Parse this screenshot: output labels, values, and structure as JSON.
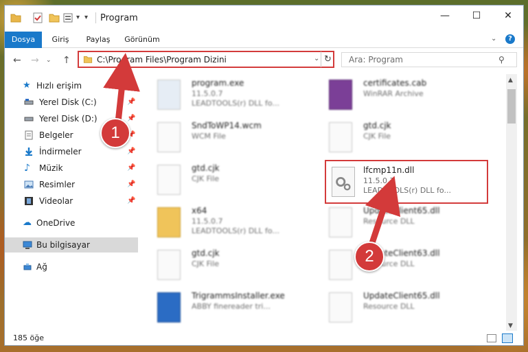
{
  "window": {
    "title": "Program"
  },
  "ribbon": {
    "tabs": [
      "Dosya",
      "Giriş",
      "Paylaş",
      "Görünüm"
    ]
  },
  "address": {
    "path": "C:\\Program Files\\Program Dizini"
  },
  "search": {
    "placeholder": "Ara: Program"
  },
  "nav": {
    "items": [
      {
        "label": "Hızlı erişim"
      },
      {
        "label": "Yerel Disk (C:)"
      },
      {
        "label": "Yerel Disk (D:)"
      },
      {
        "label": "Belgeler"
      },
      {
        "label": "İndirmeler"
      },
      {
        "label": "Müzik"
      },
      {
        "label": "Resimler"
      },
      {
        "label": "Videolar"
      },
      {
        "label": "OneDrive"
      },
      {
        "label": "Bu bilgisayar"
      },
      {
        "label": "Ağ"
      }
    ]
  },
  "files": [
    {
      "name": "program.exe",
      "meta1": "11.5.0.7",
      "meta2": "LEADTOOLS(r) DLL fo..."
    },
    {
      "name": "certificates.cab",
      "meta1": "WinRAR Archive",
      "meta2": ""
    },
    {
      "name": "SndToWP14.wcm",
      "meta1": "WCM File",
      "meta2": ""
    },
    {
      "name": "gtd.cjk",
      "meta1": "CJK File",
      "meta2": ""
    },
    {
      "name": "gtd.cjk",
      "meta1": "CJK File",
      "meta2": ""
    },
    {
      "name": "lfcmp11n.dll",
      "meta1": "11.5.0.7",
      "meta2": "LEADTOOLS(r) DLL fo..."
    },
    {
      "name": "x64",
      "meta1": "11.5.0.7",
      "meta2": "LEADTOOLS(r) DLL fo..."
    },
    {
      "name": "UpdateClient65.dll",
      "meta1": "Resource DLL",
      "meta2": ""
    },
    {
      "name": "gtd.cjk",
      "meta1": "CJK File",
      "meta2": ""
    },
    {
      "name": "UpdateClient63.dll",
      "meta1": "Resource DLL",
      "meta2": ""
    },
    {
      "name": "TrigrammsInstaller.exe",
      "meta1": "ABBY finereader tri...",
      "meta2": ""
    },
    {
      "name": "UpdateClient65.dll",
      "meta1": "Resource DLL",
      "meta2": ""
    }
  ],
  "status": {
    "count": "185 öğe"
  },
  "callouts": [
    "1",
    "2"
  ],
  "colors": {
    "accent": "#1979ca",
    "highlight": "#d33a3a"
  }
}
